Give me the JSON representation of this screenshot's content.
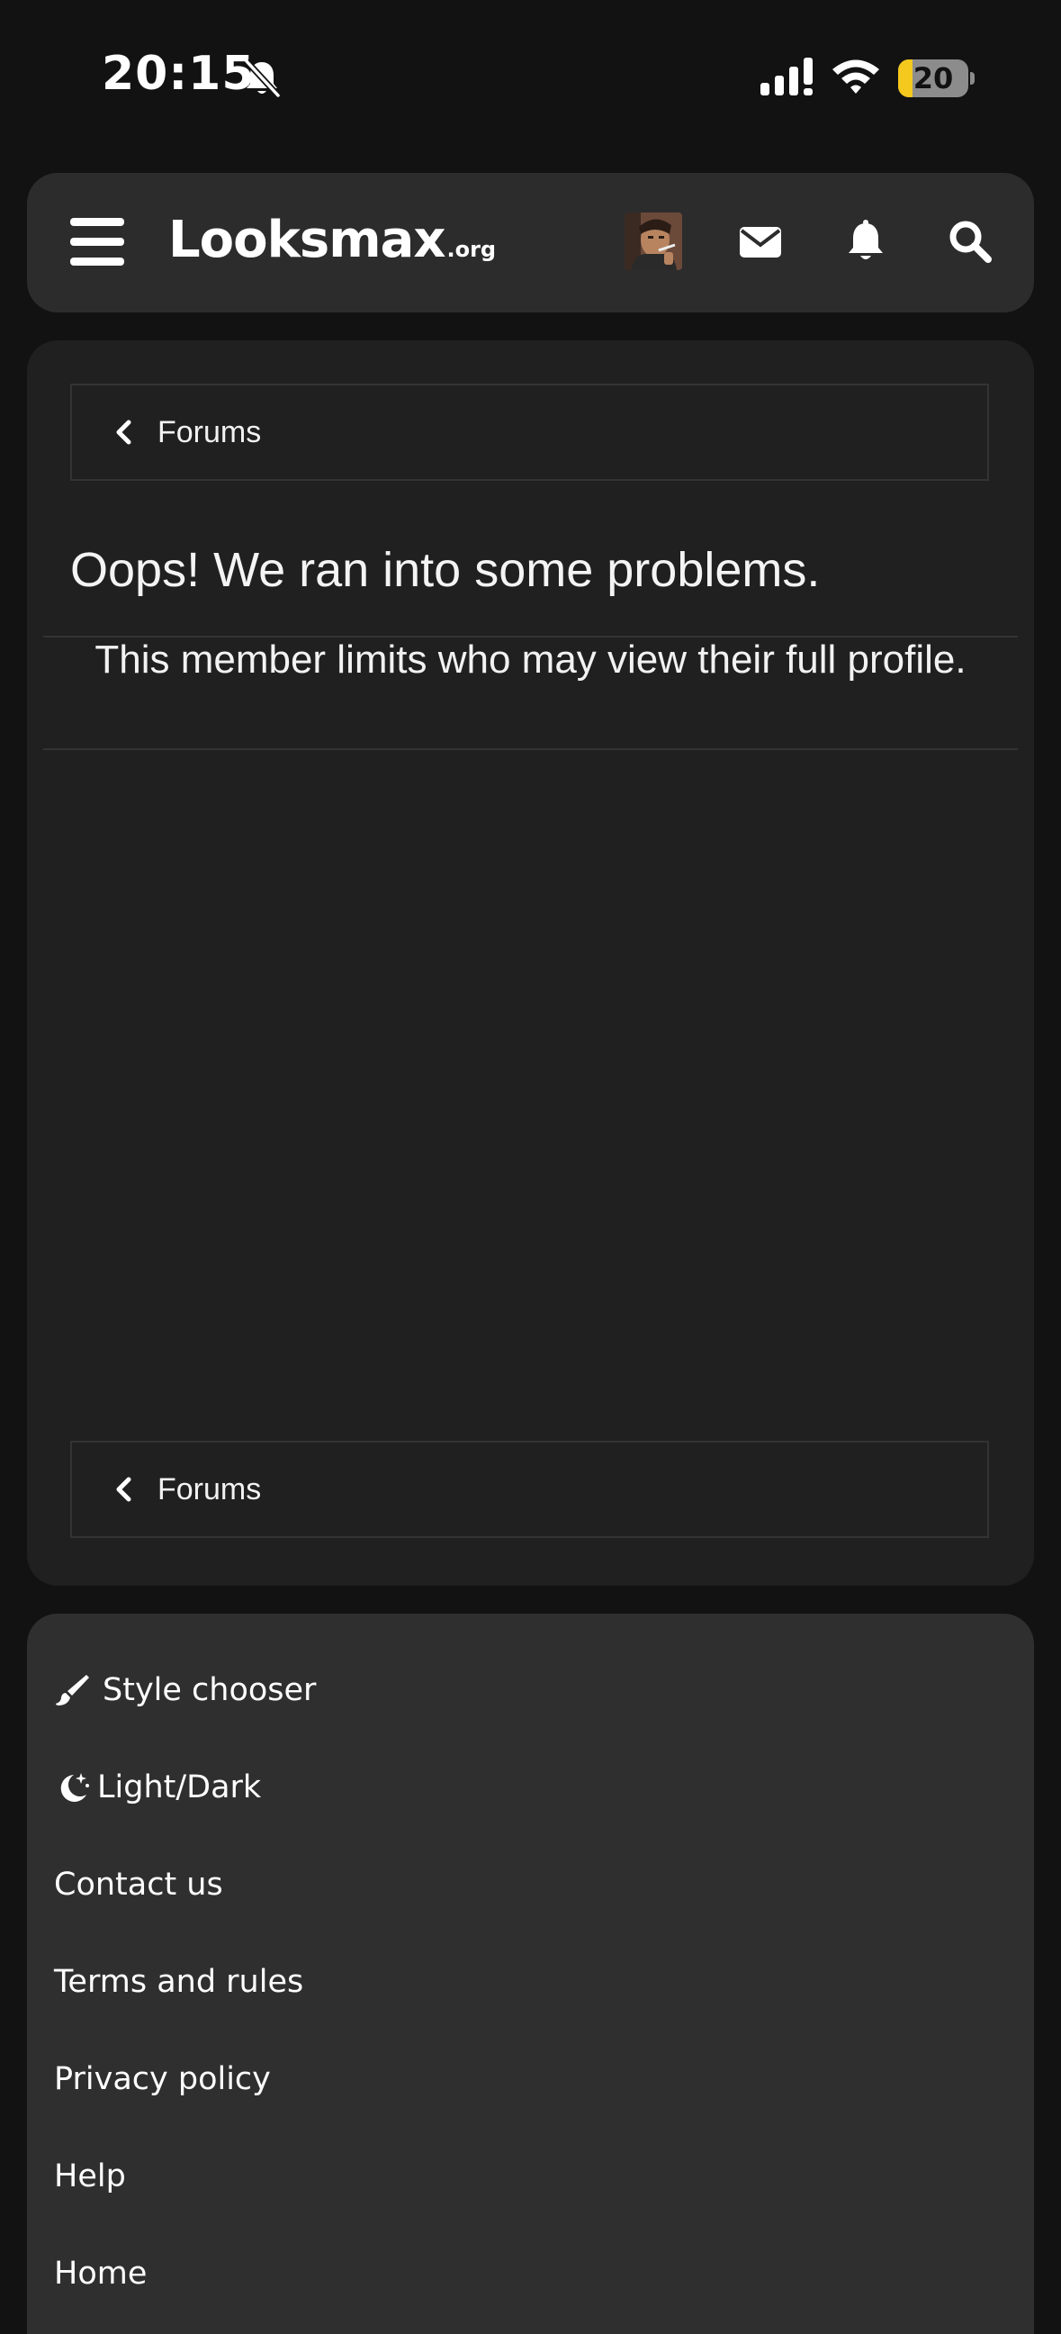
{
  "status_bar": {
    "time": "20:15",
    "battery_level": "20",
    "battery_fraction": 0.2,
    "silent_icon": "bell-off-icon",
    "signal_icon": "cellular-signal-icon",
    "wifi_icon": "wifi-icon"
  },
  "header": {
    "logo_main": "Looksmax",
    "logo_sub": ".org",
    "menu_icon": "hamburger-menu-icon",
    "avatar_icon": "user-avatar",
    "messages_icon": "envelope-icon",
    "alerts_icon": "bell-icon",
    "search_icon": "search-icon"
  },
  "main": {
    "breadcrumb_top": "Forums",
    "title": "Oops! We ran into some problems.",
    "message": "This member limits who may view their full profile.",
    "breadcrumb_bottom": "Forums"
  },
  "footer": {
    "items": [
      {
        "label": "Style chooser",
        "icon": "paintbrush-icon"
      },
      {
        "label": "Light/Dark",
        "icon": "moon-stars-icon"
      },
      {
        "label": "Contact us"
      },
      {
        "label": "Terms and rules"
      },
      {
        "label": "Privacy policy"
      },
      {
        "label": "Help"
      },
      {
        "label": "Home"
      }
    ]
  },
  "colors": {
    "page_background": "#121212",
    "header_background": "#2c2c2c",
    "card_background": "#202020",
    "footer_background": "#2f2f2f",
    "battery_accent": "#f4c81c"
  }
}
